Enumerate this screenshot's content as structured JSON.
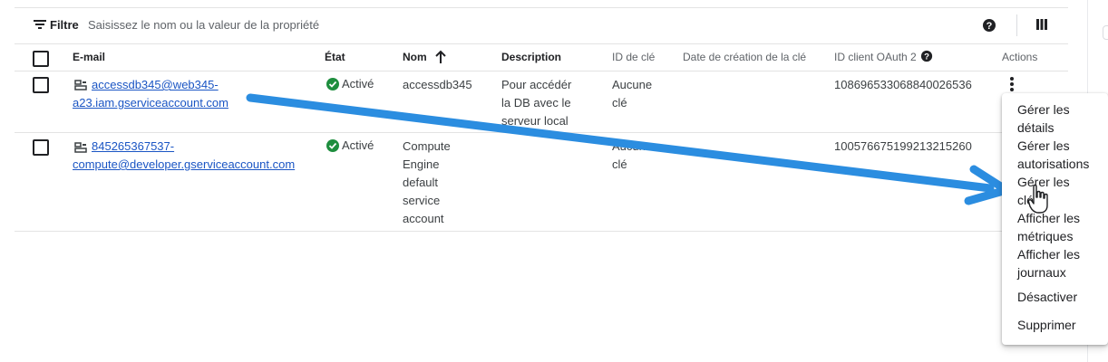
{
  "filter": {
    "label": "Filtre",
    "placeholder": "Saisissez le nom ou la valeur de la propriété"
  },
  "table": {
    "headers": {
      "email": "E-mail",
      "state": "État",
      "name": "Nom",
      "description": "Description",
      "key_id": "ID de clé",
      "key_created": "Date de création de la clé",
      "oauth_id": "ID client OAuth 2",
      "actions": "Actions"
    },
    "rows": [
      {
        "email_line1": "accessdb345@web345-",
        "email_line2": "a23.iam.gserviceaccount.com",
        "state": "Activé",
        "name": "accessdb345",
        "description": [
          "Pour accédér",
          "la DB avec le",
          "serveur local"
        ],
        "key_id": [
          "Aucune",
          "clé"
        ],
        "oauth_id": "108696533068840026536"
      },
      {
        "email_line1": "845265367537-",
        "email_line2": "compute@developer.gserviceaccount.com",
        "state": "Activé",
        "name": [
          "Compute",
          "Engine",
          "default",
          "service",
          "account"
        ],
        "key_id": [
          "Aucune",
          "clé"
        ],
        "oauth_id": "100576675199213215260"
      }
    ]
  },
  "menu": {
    "items": [
      [
        "Gérer les",
        "détails"
      ],
      [
        "Gérer les",
        "autorisations"
      ],
      [
        "Gérer les",
        "clés"
      ],
      [
        "Afficher les",
        "métriques"
      ],
      [
        "Afficher les",
        "journaux"
      ],
      [
        "Désactiver"
      ],
      [
        "Supprimer"
      ]
    ]
  },
  "colors": {
    "link": "#1a55c4",
    "status_green": "#1e8e3e",
    "annotation_arrow": "#2b8de0"
  },
  "icons": [
    "filter-icon",
    "help-icon",
    "columns-icon",
    "service-account-key-icon",
    "check-circle-icon",
    "sort-arrow-up-icon",
    "kebab-menu-icon",
    "pointer-hand-icon"
  ]
}
